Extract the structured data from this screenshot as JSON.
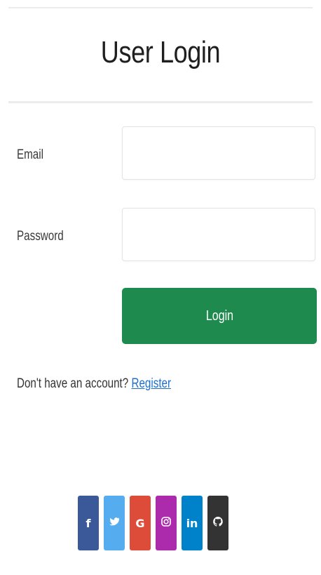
{
  "title": "User Login",
  "form": {
    "email_label": "Email",
    "email_value": "",
    "email_placeholder": "",
    "password_label": "Password",
    "password_value": "",
    "password_placeholder": "",
    "login_label": "Login"
  },
  "register": {
    "prompt": "Don't have an account?",
    "link_label": "Register"
  },
  "socials": [
    {
      "name": "facebook-icon",
      "glyph": "f",
      "color": "#3b5998"
    },
    {
      "name": "twitter-icon",
      "glyph": "",
      "color": "#55acee"
    },
    {
      "name": "google-icon",
      "glyph": "G",
      "color": "#dd4b39"
    },
    {
      "name": "instagram-icon",
      "glyph": "",
      "color": "#ac2bac"
    },
    {
      "name": "linkedin-icon",
      "glyph": "in",
      "color": "#0082ca"
    },
    {
      "name": "github-icon",
      "glyph": "",
      "color": "#333333"
    }
  ],
  "colors": {
    "login_button": "#1f8a4e",
    "link": "#1f6fd0"
  }
}
